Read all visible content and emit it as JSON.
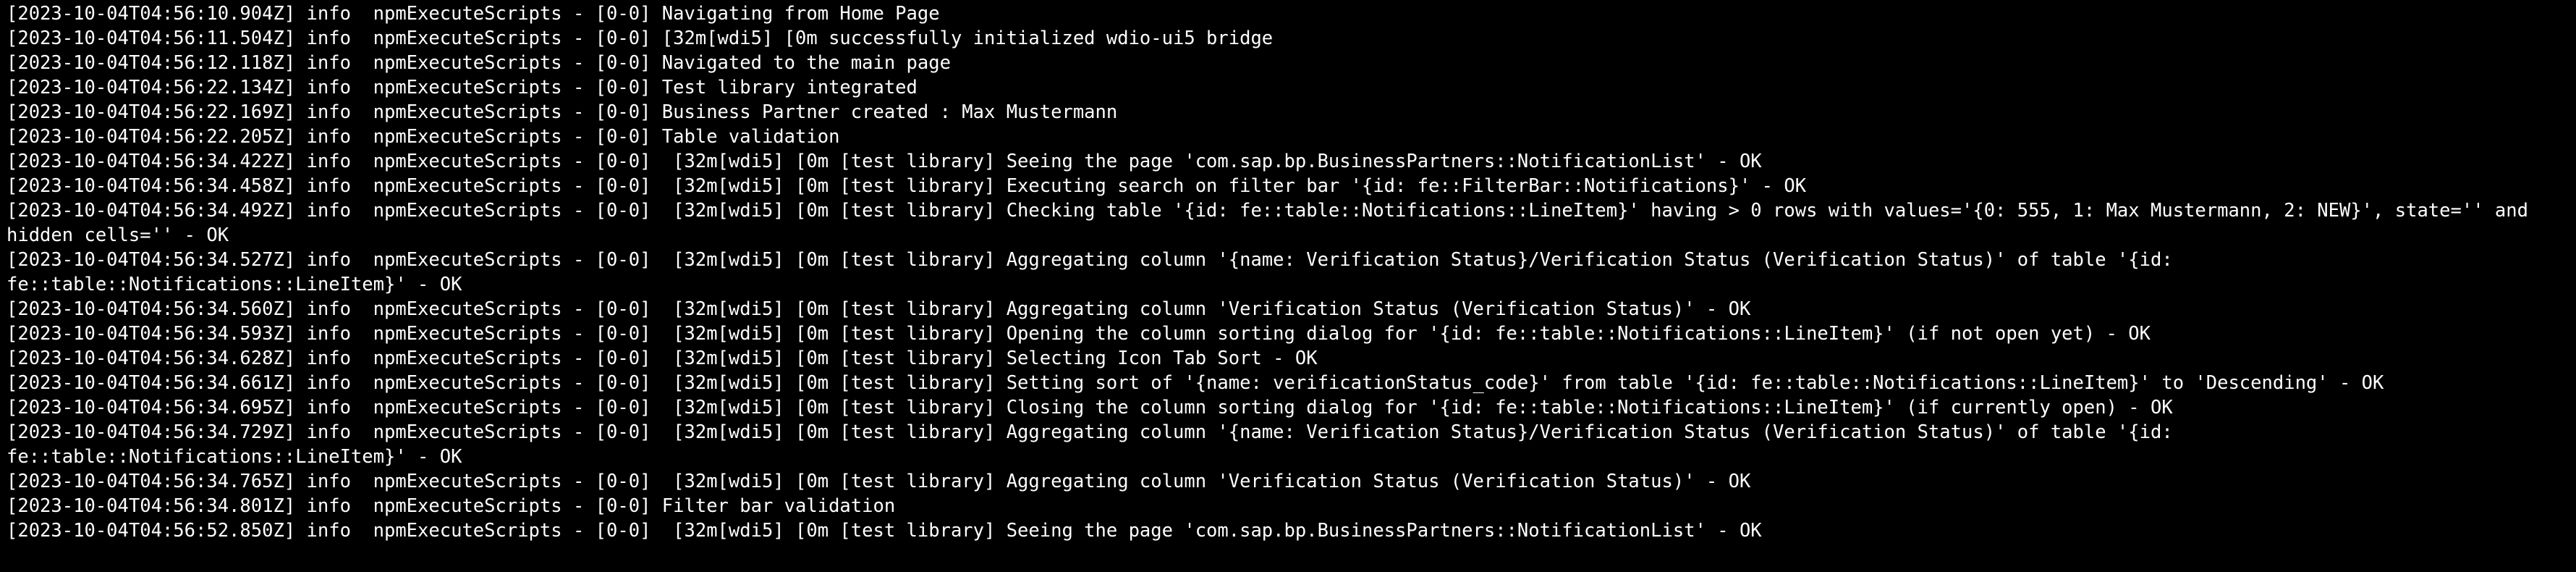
{
  "terminal": {
    "lines": [
      {
        "text": "[2023-10-04T04:56:10.904Z] info  npmExecuteScripts - [0-0] Navigating from Home Page"
      },
      {
        "text": "[2023-10-04T04:56:11.504Z] info  npmExecuteScripts - [0-0] [32m[wdi5] [0m successfully initialized wdio-ui5 bridge"
      },
      {
        "text": "[2023-10-04T04:56:12.118Z] info  npmExecuteScripts - [0-0] Navigated to the main page"
      },
      {
        "text": "[2023-10-04T04:56:22.134Z] info  npmExecuteScripts - [0-0] Test library integrated"
      },
      {
        "text": "[2023-10-04T04:56:22.169Z] info  npmExecuteScripts - [0-0] Business Partner created : Max Mustermann"
      },
      {
        "text": "[2023-10-04T04:56:22.205Z] info  npmExecuteScripts - [0-0] Table validation"
      },
      {
        "text": "[2023-10-04T04:56:34.422Z] info  npmExecuteScripts - [0-0]  [32m[wdi5] [0m [test library] Seeing the page 'com.sap.bp.BusinessPartners::NotificationList' - OK"
      },
      {
        "text": "[2023-10-04T04:56:34.458Z] info  npmExecuteScripts - [0-0]  [32m[wdi5] [0m [test library] Executing search on filter bar '{id: fe::FilterBar::Notifications}' - OK"
      },
      {
        "text": "[2023-10-04T04:56:34.492Z] info  npmExecuteScripts - [0-0]  [32m[wdi5] [0m [test library] Checking table '{id: fe::table::Notifications::LineItem}' having > 0 rows with values='{0: 555, 1: Max Mustermann, 2: NEW}', state='' and"
      },
      {
        "text": "hidden cells='' - OK"
      },
      {
        "text": "[2023-10-04T04:56:34.527Z] info  npmExecuteScripts - [0-0]  [32m[wdi5] [0m [test library] Aggregating column '{name: Verification Status}/Verification Status (Verification Status)' of table '{id:"
      },
      {
        "text": "fe::table::Notifications::LineItem}' - OK"
      },
      {
        "text": "[2023-10-04T04:56:34.560Z] info  npmExecuteScripts - [0-0]  [32m[wdi5] [0m [test library] Aggregating column 'Verification Status (Verification Status)' - OK"
      },
      {
        "text": "[2023-10-04T04:56:34.593Z] info  npmExecuteScripts - [0-0]  [32m[wdi5] [0m [test library] Opening the column sorting dialog for '{id: fe::table::Notifications::LineItem}' (if not open yet) - OK"
      },
      {
        "text": "[2023-10-04T04:56:34.628Z] info  npmExecuteScripts - [0-0]  [32m[wdi5] [0m [test library] Selecting Icon Tab Sort - OK"
      },
      {
        "text": "[2023-10-04T04:56:34.661Z] info  npmExecuteScripts - [0-0]  [32m[wdi5] [0m [test library] Setting sort of '{name: verificationStatus_code}' from table '{id: fe::table::Notifications::LineItem}' to 'Descending' - OK"
      },
      {
        "text": "[2023-10-04T04:56:34.695Z] info  npmExecuteScripts - [0-0]  [32m[wdi5] [0m [test library] Closing the column sorting dialog for '{id: fe::table::Notifications::LineItem}' (if currently open) - OK"
      },
      {
        "text": "[2023-10-04T04:56:34.729Z] info  npmExecuteScripts - [0-0]  [32m[wdi5] [0m [test library] Aggregating column '{name: Verification Status}/Verification Status (Verification Status)' of table '{id:"
      },
      {
        "text": "fe::table::Notifications::LineItem}' - OK"
      },
      {
        "text": "[2023-10-04T04:56:34.765Z] info  npmExecuteScripts - [0-0]  [32m[wdi5] [0m [test library] Aggregating column 'Verification Status (Verification Status)' - OK"
      },
      {
        "text": "[2023-10-04T04:56:34.801Z] info  npmExecuteScripts - [0-0] Filter bar validation"
      },
      {
        "text": "[2023-10-04T04:56:52.850Z] info  npmExecuteScripts - [0-0]  [32m[wdi5] [0m [test library] Seeing the page 'com.sap.bp.BusinessPartners::NotificationList' - OK"
      }
    ]
  }
}
